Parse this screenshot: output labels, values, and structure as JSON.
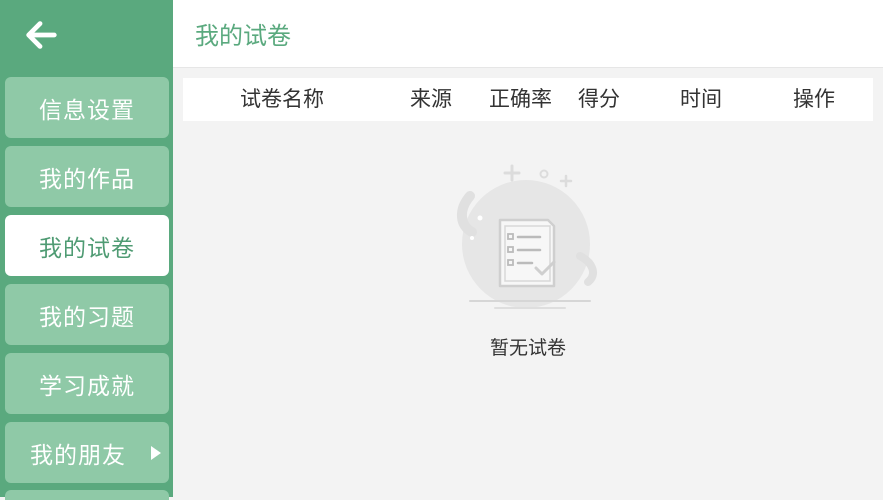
{
  "header": {
    "title": "我的试卷"
  },
  "sidebar": {
    "items": [
      {
        "label": "信息设置"
      },
      {
        "label": "我的作品"
      },
      {
        "label": "我的试卷"
      },
      {
        "label": "我的习题"
      },
      {
        "label": "学习成就"
      },
      {
        "label": "我的朋友"
      }
    ]
  },
  "table": {
    "columns": [
      "试卷名称",
      "来源",
      "正确率",
      "得分",
      "时间",
      "操作"
    ]
  },
  "empty_state": {
    "message": "暂无试卷"
  },
  "colors": {
    "accent": "#5aa97e",
    "sidebar_item": "#8fc9a7",
    "active": "#ffffff"
  }
}
